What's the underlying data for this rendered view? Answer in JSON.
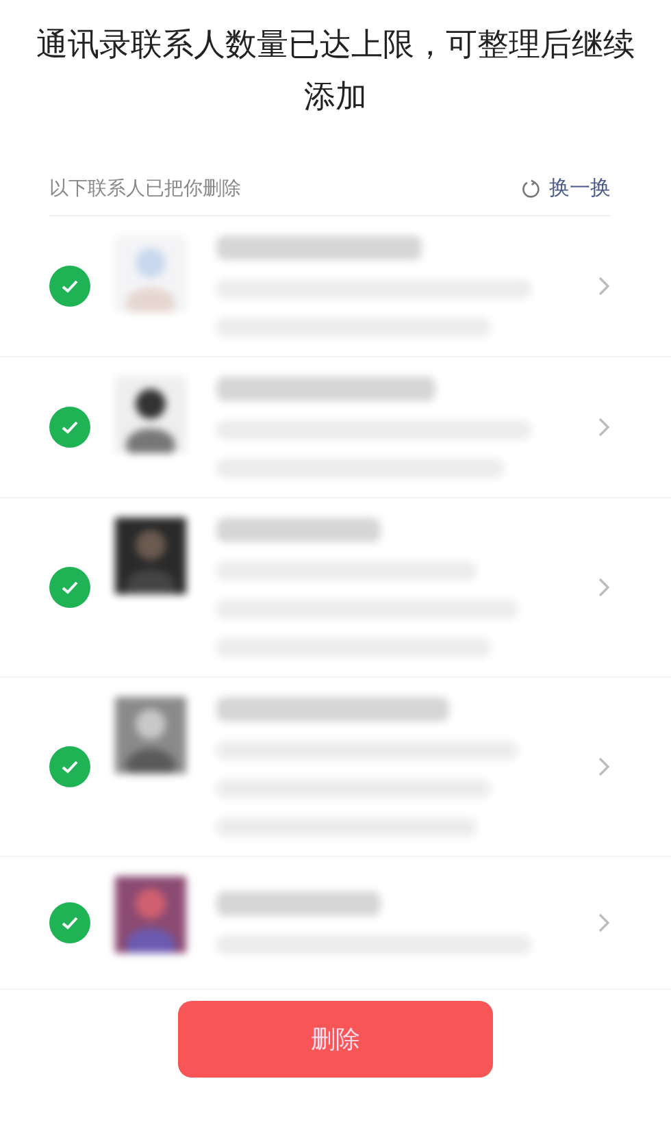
{
  "title": "通讯录联系人数量已达上限，可整理后继续添加",
  "list_header": {
    "label": "以下联系人已把你删除",
    "refresh": "换一换"
  },
  "contacts": [
    {
      "checked": true
    },
    {
      "checked": true
    },
    {
      "checked": true
    },
    {
      "checked": true
    },
    {
      "checked": true
    }
  ],
  "delete_button": "删除"
}
